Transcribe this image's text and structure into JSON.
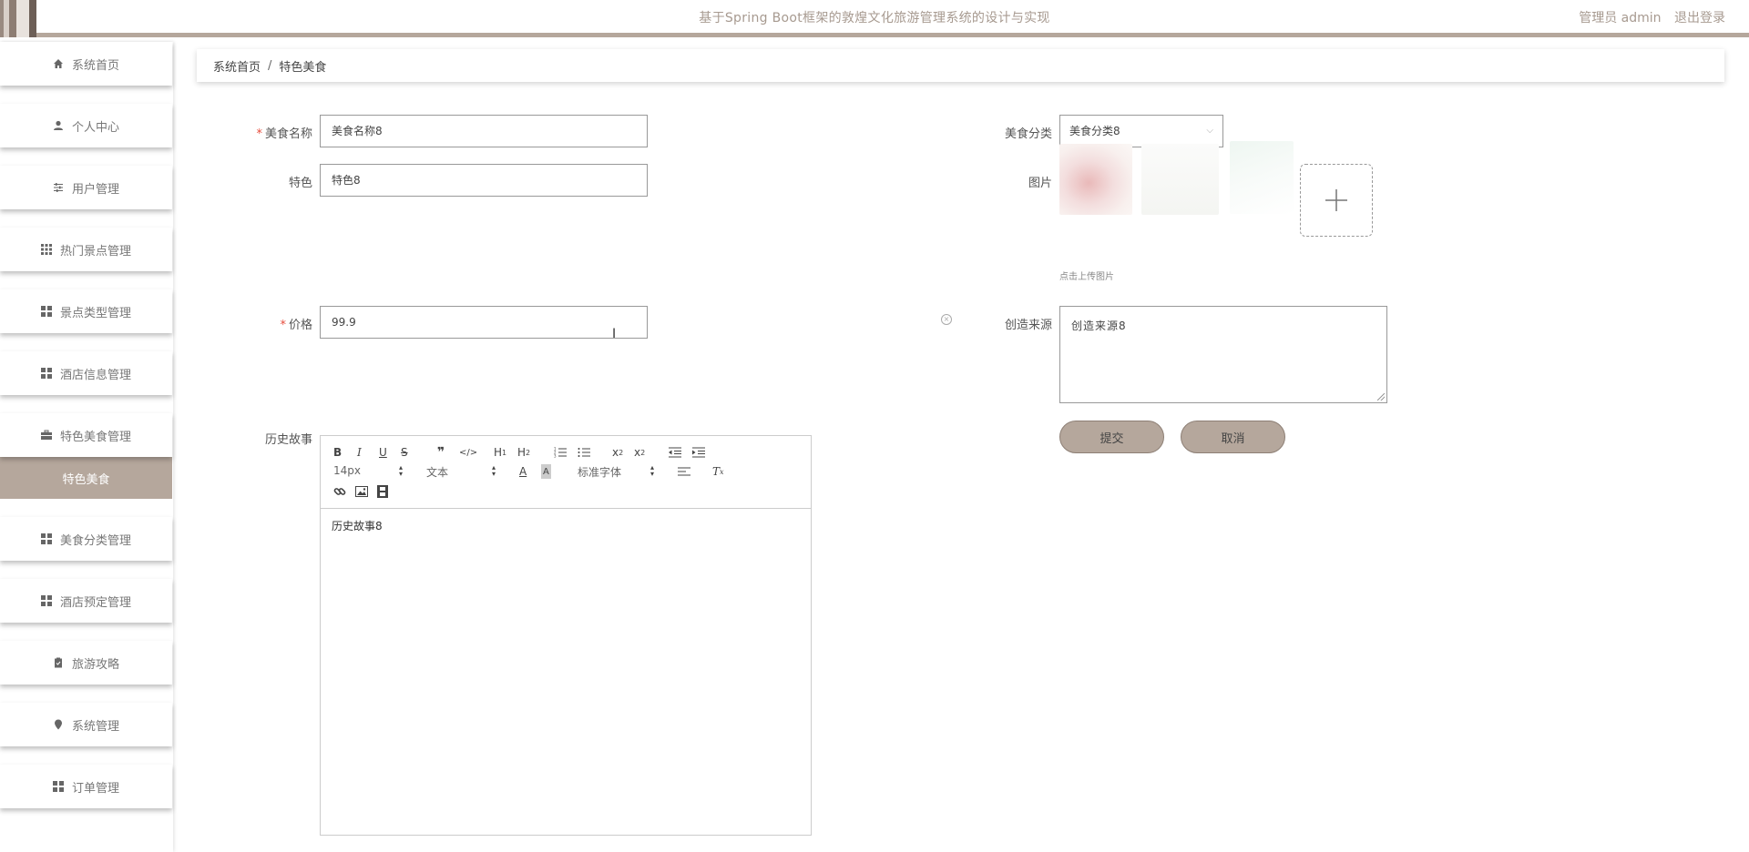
{
  "header": {
    "title": "基于Spring Boot框架的敦煌文化旅游管理系统的设计与实现",
    "user_label": "管理员 admin",
    "logout_label": "退出登录"
  },
  "sidebar": {
    "items": [
      {
        "label": "系统首页",
        "icon": "home-icon"
      },
      {
        "label": "个人中心",
        "icon": "user-icon"
      },
      {
        "label": "用户管理",
        "icon": "sliders-icon"
      },
      {
        "label": "热门景点管理",
        "icon": "grid-icon"
      },
      {
        "label": "景点类型管理",
        "icon": "grid-icon"
      },
      {
        "label": "酒店信息管理",
        "icon": "grid-icon"
      },
      {
        "label": "特色美食管理",
        "icon": "briefcase-icon"
      },
      {
        "label": "美食分类管理",
        "icon": "grid-icon"
      },
      {
        "label": "酒店预定管理",
        "icon": "grid-icon"
      },
      {
        "label": "旅游攻略",
        "icon": "clipboard-icon"
      },
      {
        "label": "系统管理",
        "icon": "pin-icon"
      },
      {
        "label": "订单管理",
        "icon": "grid-icon"
      }
    ],
    "active_sub_item": "特色美食"
  },
  "breadcrumb": {
    "home": "系统首页",
    "separator": "/",
    "current": "特色美食"
  },
  "form": {
    "required_mark": "*",
    "food_name_label": "美食名称",
    "food_name_value": "美食名称8",
    "category_label": "美食分类",
    "category_value": "美食分类8",
    "feature_label": "特色",
    "feature_value": "特色8",
    "image_label": "图片",
    "upload_tip": "点击上传图片",
    "price_label": "价格",
    "price_value": "99.9",
    "source_label": "创造来源",
    "source_value": "创造来源8",
    "history_label": "历史故事",
    "submit_label": "提交",
    "cancel_label": "取消"
  },
  "editor": {
    "font_size": "14px",
    "block_type": "文本",
    "font_family": "标准字体",
    "content": "历史故事8"
  },
  "colors": {
    "accent": "#b5a79c",
    "required": "#e74c3c"
  }
}
